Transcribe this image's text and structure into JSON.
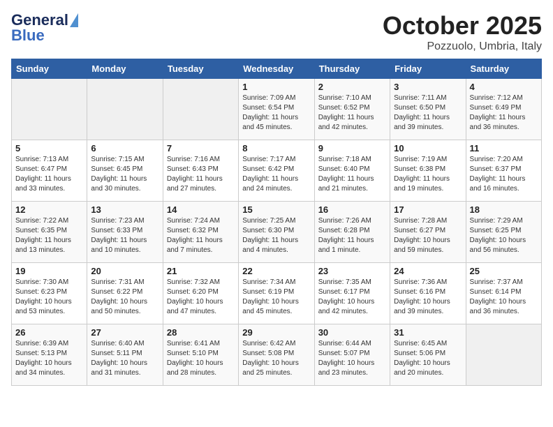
{
  "header": {
    "logo_line1": "General",
    "logo_line2": "Blue",
    "title": "October 2025",
    "subtitle": "Pozzuolo, Umbria, Italy"
  },
  "days_of_week": [
    "Sunday",
    "Monday",
    "Tuesday",
    "Wednesday",
    "Thursday",
    "Friday",
    "Saturday"
  ],
  "weeks": [
    [
      {
        "day": "",
        "text": ""
      },
      {
        "day": "",
        "text": ""
      },
      {
        "day": "",
        "text": ""
      },
      {
        "day": "1",
        "text": "Sunrise: 7:09 AM\nSunset: 6:54 PM\nDaylight: 11 hours and 45 minutes."
      },
      {
        "day": "2",
        "text": "Sunrise: 7:10 AM\nSunset: 6:52 PM\nDaylight: 11 hours and 42 minutes."
      },
      {
        "day": "3",
        "text": "Sunrise: 7:11 AM\nSunset: 6:50 PM\nDaylight: 11 hours and 39 minutes."
      },
      {
        "day": "4",
        "text": "Sunrise: 7:12 AM\nSunset: 6:49 PM\nDaylight: 11 hours and 36 minutes."
      }
    ],
    [
      {
        "day": "5",
        "text": "Sunrise: 7:13 AM\nSunset: 6:47 PM\nDaylight: 11 hours and 33 minutes."
      },
      {
        "day": "6",
        "text": "Sunrise: 7:15 AM\nSunset: 6:45 PM\nDaylight: 11 hours and 30 minutes."
      },
      {
        "day": "7",
        "text": "Sunrise: 7:16 AM\nSunset: 6:43 PM\nDaylight: 11 hours and 27 minutes."
      },
      {
        "day": "8",
        "text": "Sunrise: 7:17 AM\nSunset: 6:42 PM\nDaylight: 11 hours and 24 minutes."
      },
      {
        "day": "9",
        "text": "Sunrise: 7:18 AM\nSunset: 6:40 PM\nDaylight: 11 hours and 21 minutes."
      },
      {
        "day": "10",
        "text": "Sunrise: 7:19 AM\nSunset: 6:38 PM\nDaylight: 11 hours and 19 minutes."
      },
      {
        "day": "11",
        "text": "Sunrise: 7:20 AM\nSunset: 6:37 PM\nDaylight: 11 hours and 16 minutes."
      }
    ],
    [
      {
        "day": "12",
        "text": "Sunrise: 7:22 AM\nSunset: 6:35 PM\nDaylight: 11 hours and 13 minutes."
      },
      {
        "day": "13",
        "text": "Sunrise: 7:23 AM\nSunset: 6:33 PM\nDaylight: 11 hours and 10 minutes."
      },
      {
        "day": "14",
        "text": "Sunrise: 7:24 AM\nSunset: 6:32 PM\nDaylight: 11 hours and 7 minutes."
      },
      {
        "day": "15",
        "text": "Sunrise: 7:25 AM\nSunset: 6:30 PM\nDaylight: 11 hours and 4 minutes."
      },
      {
        "day": "16",
        "text": "Sunrise: 7:26 AM\nSunset: 6:28 PM\nDaylight: 11 hours and 1 minute."
      },
      {
        "day": "17",
        "text": "Sunrise: 7:28 AM\nSunset: 6:27 PM\nDaylight: 10 hours and 59 minutes."
      },
      {
        "day": "18",
        "text": "Sunrise: 7:29 AM\nSunset: 6:25 PM\nDaylight: 10 hours and 56 minutes."
      }
    ],
    [
      {
        "day": "19",
        "text": "Sunrise: 7:30 AM\nSunset: 6:23 PM\nDaylight: 10 hours and 53 minutes."
      },
      {
        "day": "20",
        "text": "Sunrise: 7:31 AM\nSunset: 6:22 PM\nDaylight: 10 hours and 50 minutes."
      },
      {
        "day": "21",
        "text": "Sunrise: 7:32 AM\nSunset: 6:20 PM\nDaylight: 10 hours and 47 minutes."
      },
      {
        "day": "22",
        "text": "Sunrise: 7:34 AM\nSunset: 6:19 PM\nDaylight: 10 hours and 45 minutes."
      },
      {
        "day": "23",
        "text": "Sunrise: 7:35 AM\nSunset: 6:17 PM\nDaylight: 10 hours and 42 minutes."
      },
      {
        "day": "24",
        "text": "Sunrise: 7:36 AM\nSunset: 6:16 PM\nDaylight: 10 hours and 39 minutes."
      },
      {
        "day": "25",
        "text": "Sunrise: 7:37 AM\nSunset: 6:14 PM\nDaylight: 10 hours and 36 minutes."
      }
    ],
    [
      {
        "day": "26",
        "text": "Sunrise: 6:39 AM\nSunset: 5:13 PM\nDaylight: 10 hours and 34 minutes."
      },
      {
        "day": "27",
        "text": "Sunrise: 6:40 AM\nSunset: 5:11 PM\nDaylight: 10 hours and 31 minutes."
      },
      {
        "day": "28",
        "text": "Sunrise: 6:41 AM\nSunset: 5:10 PM\nDaylight: 10 hours and 28 minutes."
      },
      {
        "day": "29",
        "text": "Sunrise: 6:42 AM\nSunset: 5:08 PM\nDaylight: 10 hours and 25 minutes."
      },
      {
        "day": "30",
        "text": "Sunrise: 6:44 AM\nSunset: 5:07 PM\nDaylight: 10 hours and 23 minutes."
      },
      {
        "day": "31",
        "text": "Sunrise: 6:45 AM\nSunset: 5:06 PM\nDaylight: 10 hours and 20 minutes."
      },
      {
        "day": "",
        "text": ""
      }
    ]
  ]
}
